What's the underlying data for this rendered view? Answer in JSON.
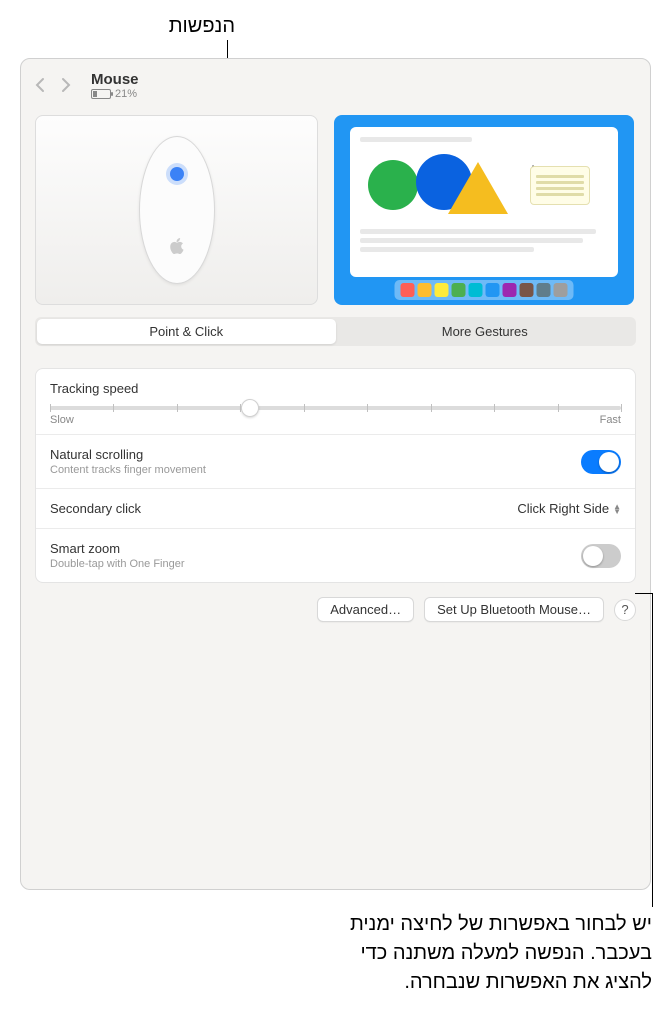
{
  "callouts": {
    "top": "הנפשות",
    "bottom_line1": "יש לבחור באפשרות של לחיצה ימנית",
    "bottom_line2": "בעכבר. הנפשה למעלה משתנה כדי",
    "bottom_line3": "להציג את האפשרות שנבחרה."
  },
  "header": {
    "title": "Mouse",
    "battery_percent": "21%"
  },
  "tabs": {
    "point_click": "Point & Click",
    "more_gestures": "More Gestures"
  },
  "settings": {
    "tracking": {
      "label": "Tracking speed",
      "slow": "Slow",
      "fast": "Fast",
      "position_percent": 35
    },
    "natural_scroll": {
      "label": "Natural scrolling",
      "sub": "Content tracks finger movement",
      "on": true
    },
    "secondary_click": {
      "label": "Secondary click",
      "value": "Click Right Side"
    },
    "smart_zoom": {
      "label": "Smart zoom",
      "sub": "Double-tap with One Finger",
      "on": false
    }
  },
  "buttons": {
    "advanced": "Advanced…",
    "setup_bluetooth": "Set Up Bluetooth Mouse…",
    "help": "?"
  },
  "dock_colors": [
    "#ff5f56",
    "#ffbd2e",
    "#ffeb3b",
    "#4caf50",
    "#00bcd4",
    "#2196f3",
    "#9c27b0",
    "#795548",
    "#607d8b",
    "#9e9e9e"
  ]
}
